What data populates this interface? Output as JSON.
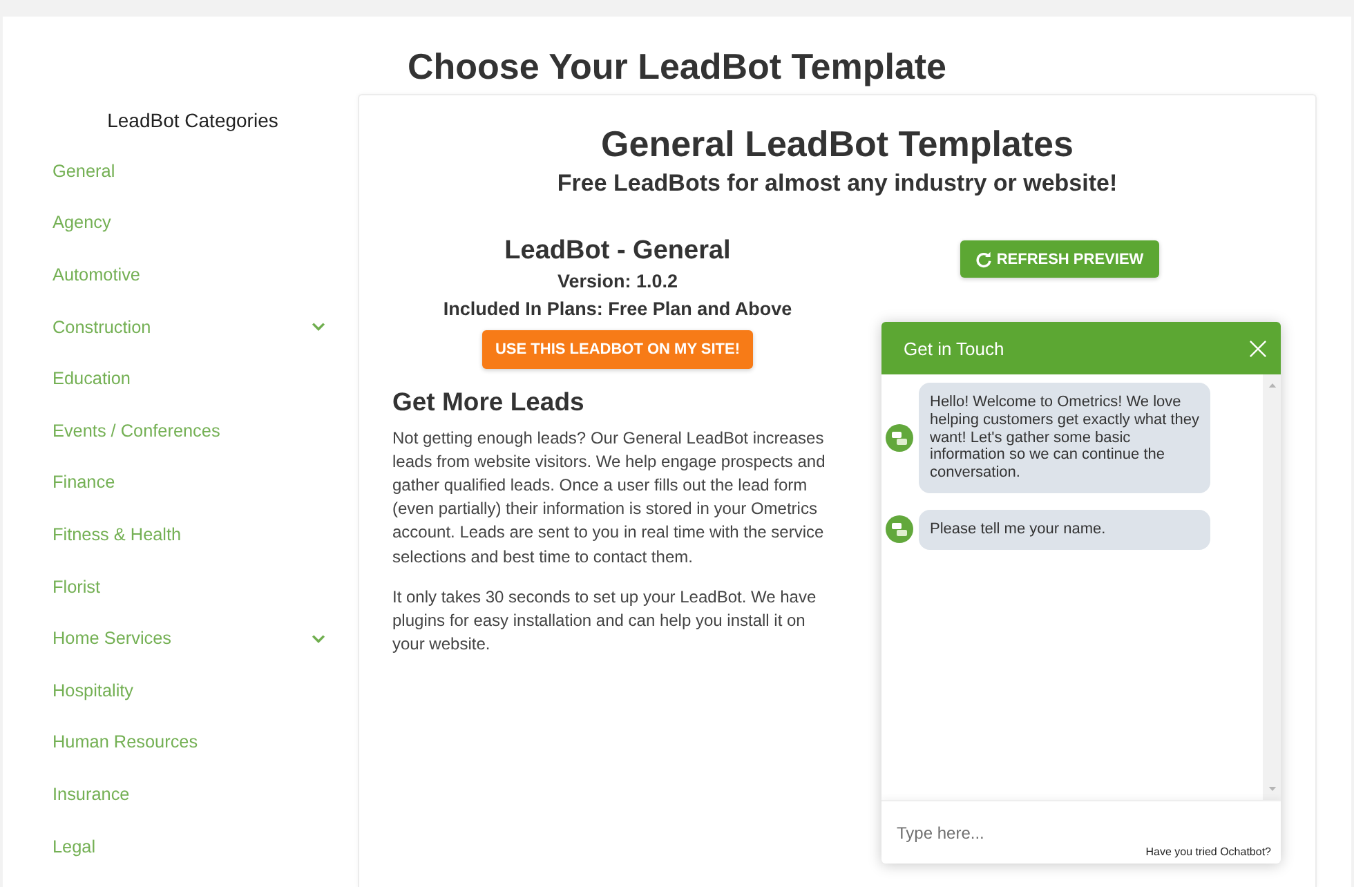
{
  "page": {
    "title": "Choose Your LeadBot Template"
  },
  "sidebar": {
    "title": "LeadBot Categories",
    "items": [
      {
        "label": "General",
        "kind": "link"
      },
      {
        "label": "Agency",
        "kind": "link"
      },
      {
        "label": "Automotive",
        "kind": "link"
      },
      {
        "label": "Construction",
        "kind": "group"
      },
      {
        "label": "Education",
        "kind": "link"
      },
      {
        "label": "Events / Conferences",
        "kind": "link"
      },
      {
        "label": "Finance",
        "kind": "link"
      },
      {
        "label": "Fitness & Health",
        "kind": "link"
      },
      {
        "label": "Florist",
        "kind": "link"
      },
      {
        "label": "Home Services",
        "kind": "group"
      },
      {
        "label": "Hospitality",
        "kind": "link"
      },
      {
        "label": "Human Resources",
        "kind": "link"
      },
      {
        "label": "Insurance",
        "kind": "link"
      },
      {
        "label": "Legal",
        "kind": "link"
      }
    ]
  },
  "content": {
    "heading": "General LeadBot Templates",
    "subheading": "Free LeadBots for almost any industry or website!",
    "template": {
      "name": "LeadBot - General",
      "version": "Version: 1.0.2",
      "plans": "Included In Plans: Free Plan and Above",
      "use_button": "USE THIS LEADBOT ON MY SITE!"
    },
    "description": {
      "heading": "Get More Leads",
      "paragraphs": [
        "Not getting enough leads? Our General LeadBot increases leads from website visitors. We help engage prospects and gather qualified leads. Once a user fills out the lead form (even partially) their information is stored in your Ometrics account. Leads are sent to you in real time with the service selections and best time to contact them.",
        "It only takes 30 seconds to set up your LeadBot. We have plugins for easy installation and can help you install it on your website."
      ]
    },
    "preview": {
      "refresh_button": "REFRESH PREVIEW",
      "chat": {
        "title": "Get in Touch",
        "messages": [
          "Hello! Welcome to Ometrics! We love helping customers get exactly what they want! Let's gather some basic information so we can continue the conversation.",
          "Please tell me your name."
        ],
        "input": {
          "placeholder": "Type here..."
        },
        "footer": "Have you tried Ochatbot?"
      }
    }
  }
}
